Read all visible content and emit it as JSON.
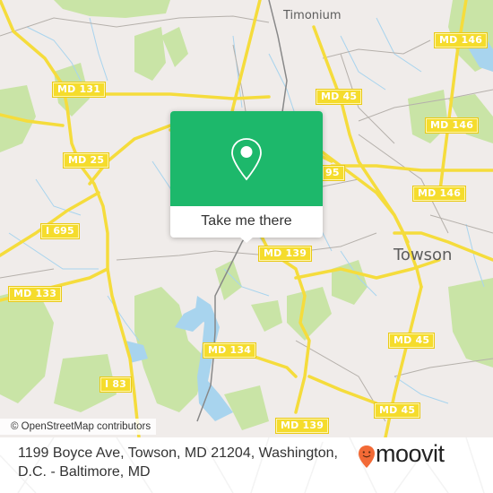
{
  "map": {
    "places": [
      {
        "id": "timonium",
        "label": "Timonium"
      },
      {
        "id": "towson",
        "label": "Towson"
      }
    ],
    "route_shields": [
      {
        "id": "md146-a",
        "label": "MD 146"
      },
      {
        "id": "md131",
        "label": "MD 131"
      },
      {
        "id": "md45-a",
        "label": "MD 45"
      },
      {
        "id": "md146-b",
        "label": "MD 146"
      },
      {
        "id": "md25",
        "label": "MD 25"
      },
      {
        "id": "i695-partial",
        "label": "95"
      },
      {
        "id": "md146-c",
        "label": "MD 146"
      },
      {
        "id": "i695",
        "label": "I 695"
      },
      {
        "id": "md139-a",
        "label": "MD 139"
      },
      {
        "id": "md133",
        "label": "MD 133"
      },
      {
        "id": "md45-b",
        "label": "MD 45"
      },
      {
        "id": "md134",
        "label": "MD 134"
      },
      {
        "id": "i83",
        "label": "I 83"
      },
      {
        "id": "md45-c",
        "label": "MD 45"
      },
      {
        "id": "md139-b",
        "label": "MD 139"
      }
    ],
    "attribution": "© OpenStreetMap contributors",
    "colors": {
      "land": "#f0ecea",
      "park": "#c9e4a6",
      "water": "#a8d4ee",
      "road": "#f5dc3c",
      "minor_road": "#b5b0ab"
    }
  },
  "popup": {
    "icon": "location-pin-icon",
    "cta_label": "Take me there",
    "accent": "#1db86b"
  },
  "footer": {
    "address": "1199 Boyce Ave, Towson, MD 21204, Washington, D.C. - Baltimore, MD",
    "brand": "moovit",
    "brand_color": "#f26a36"
  }
}
